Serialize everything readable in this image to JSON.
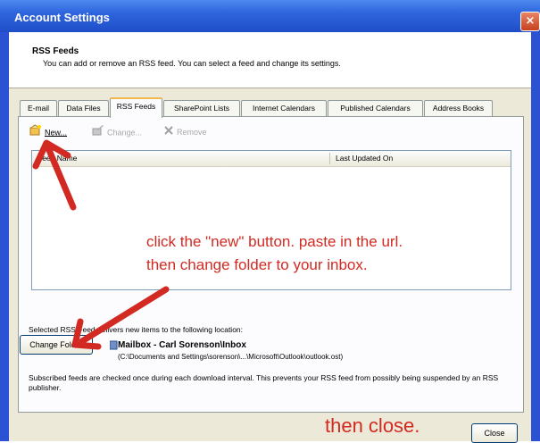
{
  "window": {
    "title": "Account Settings",
    "close_glyph": "×"
  },
  "header": {
    "title": "RSS Feeds",
    "description": "You can add or remove an RSS feed. You can select a feed and change its settings."
  },
  "tabs": [
    {
      "label": "E-mail",
      "active": false
    },
    {
      "label": "Data Files",
      "active": false
    },
    {
      "label": "RSS Feeds",
      "active": true
    },
    {
      "label": "SharePoint Lists",
      "active": false
    },
    {
      "label": "Internet Calendars",
      "active": false
    },
    {
      "label": "Published Calendars",
      "active": false
    },
    {
      "label": "Address Books",
      "active": false
    }
  ],
  "toolbar": {
    "new_label": "New...",
    "change_label": "Change...",
    "remove_label": "Remove"
  },
  "feed_list": {
    "columns": [
      "Feed Name",
      "Last Updated On"
    ],
    "rows": []
  },
  "annotations": {
    "line1": "click the \"new\" button.  paste in the url.",
    "line2": "then change folder to your inbox.",
    "close_note": "then close.",
    "arrow_color": "#d22a22"
  },
  "location": {
    "label": "Selected RSS Feed delivers new items to the following location:",
    "change_folder_label": "Change Folder",
    "mailbox_name": "Mailbox - Carl Sorenson\\Inbox",
    "mailbox_path": "(C:\\Documents and Settings\\sorenson\\...\\Microsoft\\Outlook\\outlook.ost)"
  },
  "note": "Subscribed feeds are checked once during each download interval. This prevents your RSS feed from possibly being suspended by an RSS publisher.",
  "footer": {
    "close_label": "Close"
  }
}
